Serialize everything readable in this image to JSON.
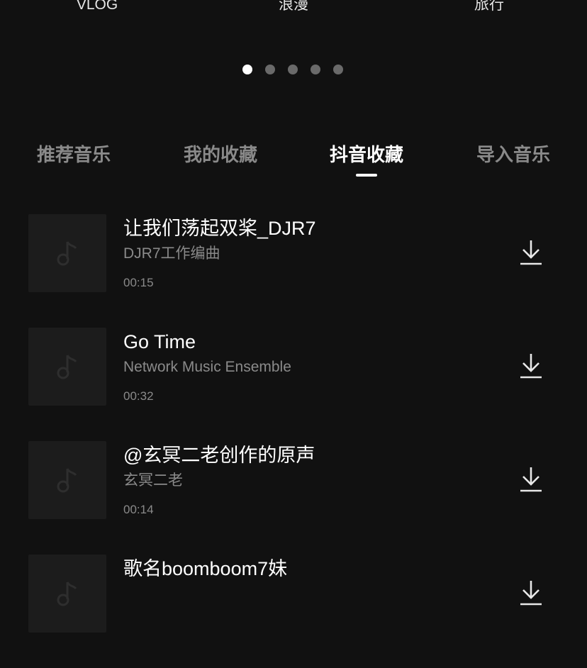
{
  "top_categories": [
    "VLOG",
    "浪漫",
    "旅行"
  ],
  "pager": {
    "count": 5,
    "active_index": 0
  },
  "tabs": [
    {
      "label": "推荐音乐",
      "active": false
    },
    {
      "label": "我的收藏",
      "active": false
    },
    {
      "label": "抖音收藏",
      "active": true
    },
    {
      "label": "导入音乐",
      "active": false
    }
  ],
  "songs": [
    {
      "title": "让我们荡起双桨_DJR7",
      "artist": "DJR7工作编曲",
      "duration": "00:15"
    },
    {
      "title": "Go Time",
      "artist": "Network Music Ensemble",
      "duration": "00:32"
    },
    {
      "title": "@玄冥二老创作的原声",
      "artist": "玄冥二老",
      "duration": "00:14"
    },
    {
      "title": "歌名boomboom7妹",
      "artist": "",
      "duration": ""
    }
  ],
  "icons": {
    "cover": "music-note-icon",
    "action": "download-icon"
  },
  "colors": {
    "background": "#111111",
    "inactive_text": "#8a8a8a",
    "active_text": "#ffffff",
    "cover_bg": "#1c1c1c"
  }
}
